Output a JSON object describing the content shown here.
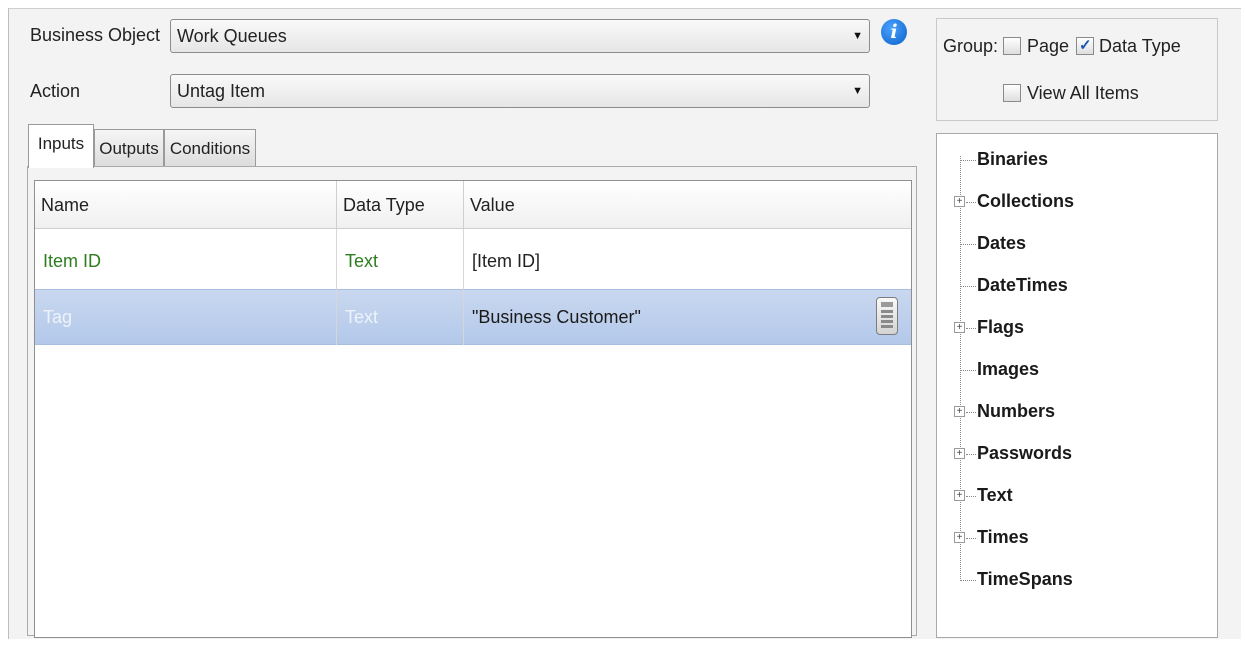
{
  "form": {
    "business_object_label": "Business Object",
    "business_object_value": "Work Queues",
    "action_label": "Action",
    "action_value": "Untag Item",
    "info_icon": "i"
  },
  "tabs": [
    {
      "label": "Inputs",
      "active": true
    },
    {
      "label": "Outputs",
      "active": false
    },
    {
      "label": "Conditions",
      "active": false
    }
  ],
  "grid": {
    "columns": [
      "Name",
      "Data Type",
      "Value"
    ],
    "rows": [
      {
        "name": "Item ID",
        "data_type": "Text",
        "value": "[Item ID]",
        "selected": false
      },
      {
        "name": "Tag",
        "data_type": "Text",
        "value": "\"Business Customer\"",
        "selected": true
      }
    ]
  },
  "group": {
    "label": "Group:",
    "page_label": "Page",
    "page_checked": false,
    "data_type_label": "Data Type",
    "data_type_checked": true,
    "view_all_label": "View All Items",
    "view_all_checked": false
  },
  "tree": {
    "items": [
      {
        "label": "Binaries",
        "expandable": false
      },
      {
        "label": "Collections",
        "expandable": true
      },
      {
        "label": "Dates",
        "expandable": false
      },
      {
        "label": "DateTimes",
        "expandable": false
      },
      {
        "label": "Flags",
        "expandable": true
      },
      {
        "label": "Images",
        "expandable": false
      },
      {
        "label": "Numbers",
        "expandable": true
      },
      {
        "label": "Passwords",
        "expandable": true
      },
      {
        "label": "Text",
        "expandable": true
      },
      {
        "label": "Times",
        "expandable": true
      },
      {
        "label": "TimeSpans",
        "expandable": false
      }
    ]
  },
  "colors": {
    "green_text": "#2e7d1f",
    "selected_row": "#b3c8ea",
    "info_blue": "#0b5fc7"
  }
}
